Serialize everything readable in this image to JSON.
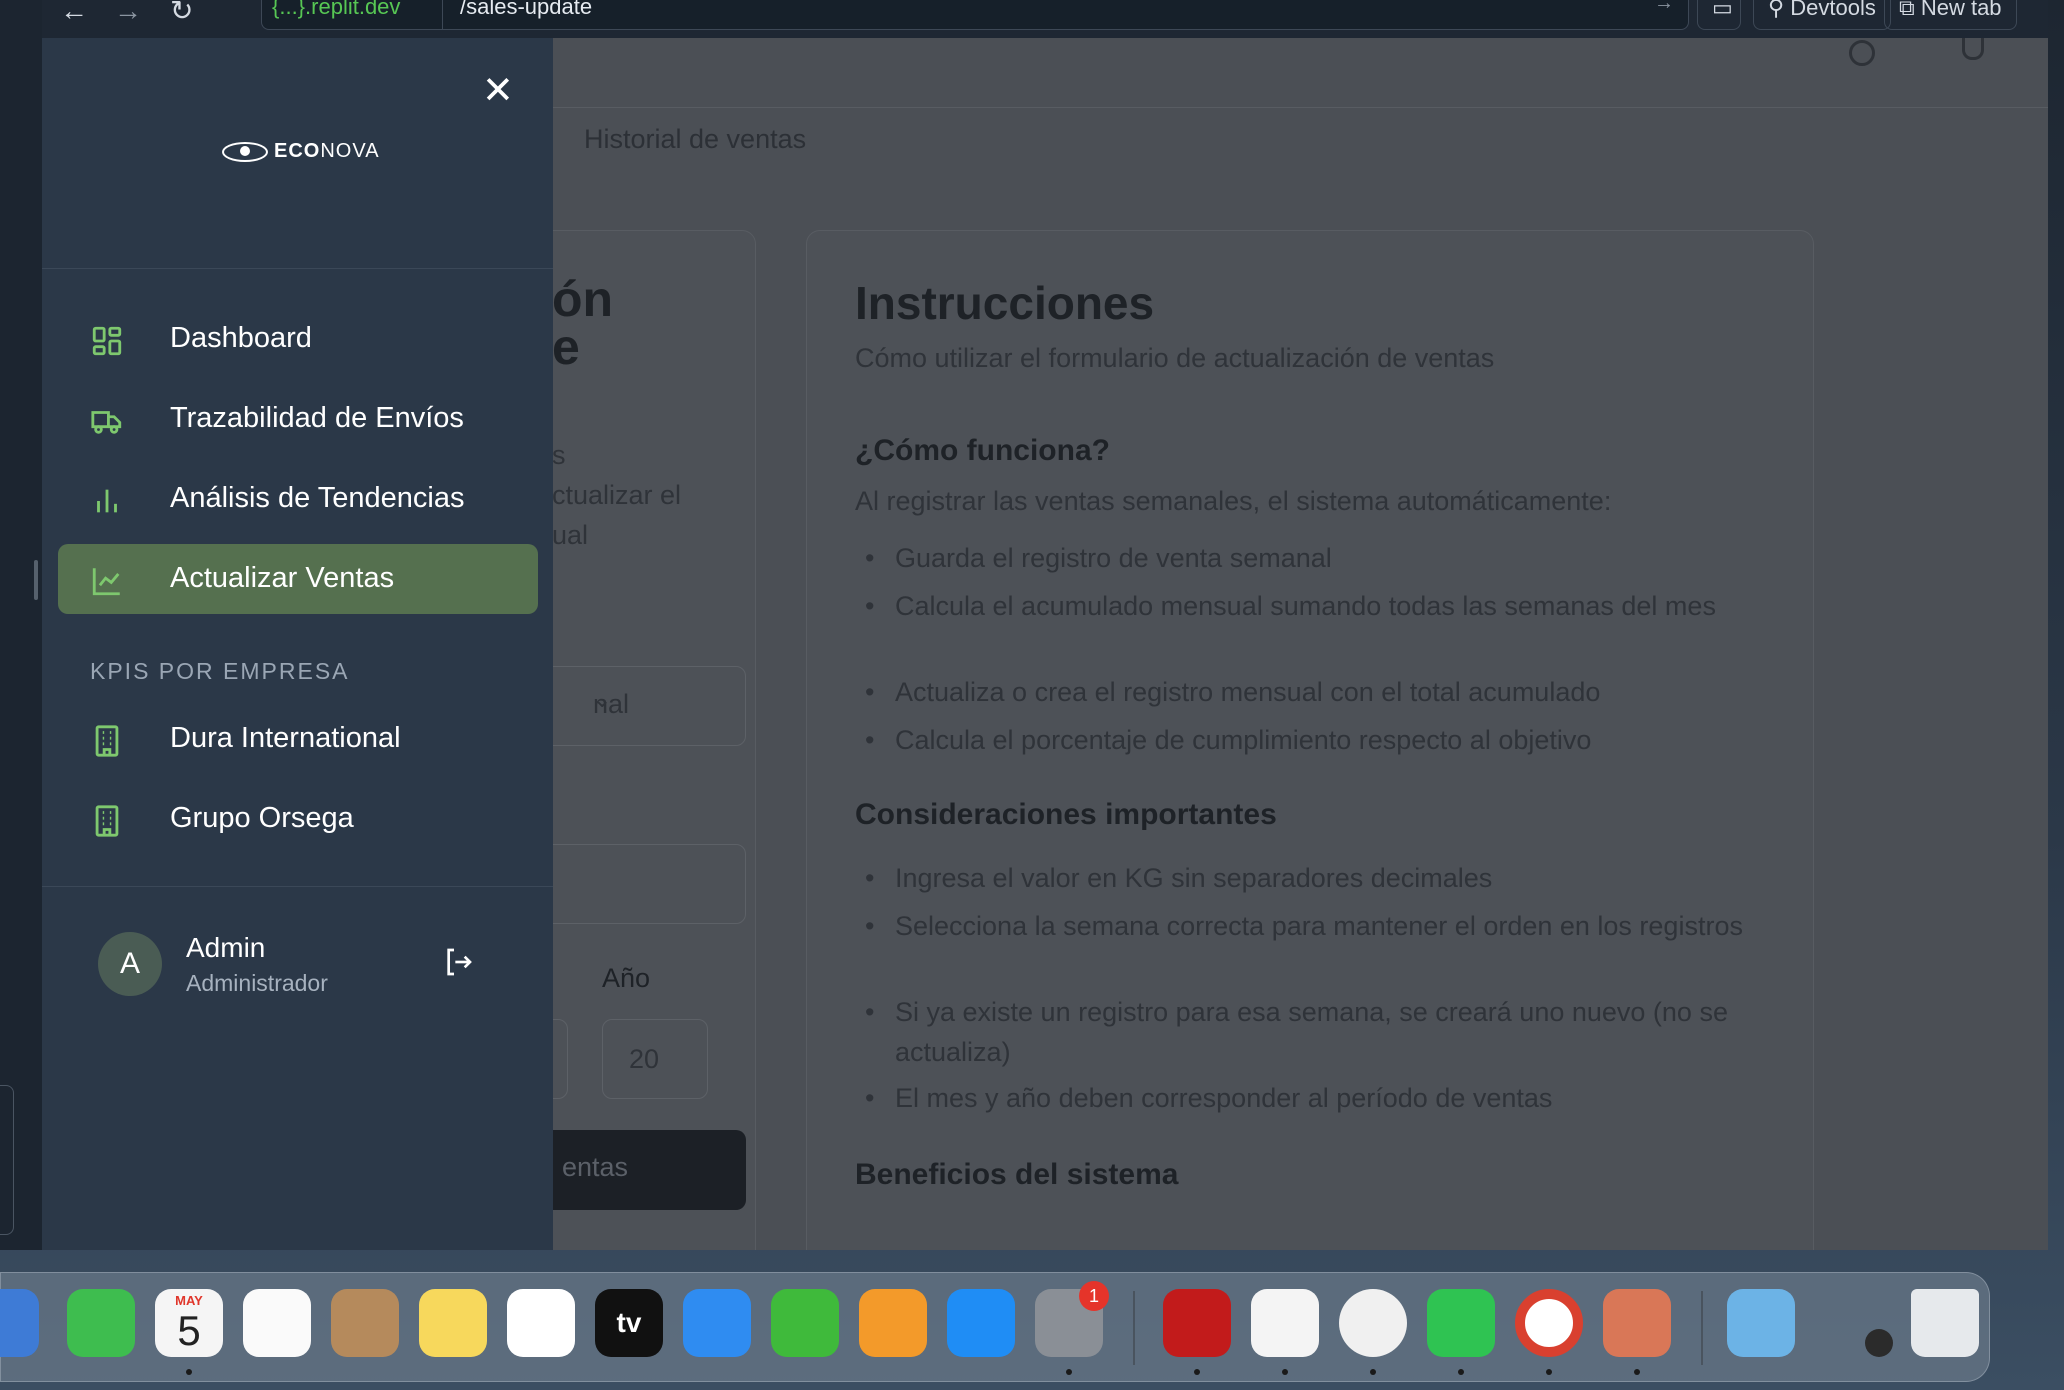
{
  "browser": {
    "url_host": "{...}.replit.dev",
    "url_path": "/sales-update",
    "devtools_label": "Devtools",
    "new_tab_label": "New tab"
  },
  "page": {
    "breadcrumb": "Historial de ventas",
    "form_title_partial": "ón\ne",
    "form_desc_partial": "s\nctualizar el\nual",
    "select_value_partial": "nal",
    "year_label": "Año",
    "year_value_partial": "20",
    "submit_partial": "entas"
  },
  "instructions": {
    "title": "Instrucciones",
    "subtitle": "Cómo utilizar el formulario de actualización de ventas",
    "section1_title": "¿Cómo funciona?",
    "section1_intro": "Al registrar las ventas semanales, el sistema automáticamente:",
    "section1_items": [
      "Guarda el registro de venta semanal",
      "Calcula el acumulado mensual sumando todas las semanas del mes",
      "Actualiza o crea el registro mensual con el total acumulado",
      "Calcula el porcentaje de cumplimiento respecto al objetivo"
    ],
    "section2_title": "Consideraciones importantes",
    "section2_items": [
      "Ingresa el valor en KG sin separadores decimales",
      "Selecciona la semana correcta para mantener el orden en los registros",
      "Si ya existe un registro para esa semana, se creará uno nuevo (no se actualiza)",
      "El mes y año deben corresponder al período de ventas"
    ],
    "section3_title": "Beneficios del sistema"
  },
  "sidebar": {
    "logo_text_bold": "ECO",
    "logo_text_rest": "NOVA",
    "nav": [
      {
        "label": "Dashboard",
        "icon": "dashboard-grid-icon"
      },
      {
        "label": "Trazabilidad de Envíos",
        "icon": "truck-icon"
      },
      {
        "label": "Análisis de Tendencias",
        "icon": "bar-chart-icon"
      },
      {
        "label": "Actualizar Ventas",
        "icon": "line-chart-icon",
        "active": true
      }
    ],
    "section_label": "KPIS POR EMPRESA",
    "companies": [
      {
        "label": "Dura International",
        "icon": "building-icon"
      },
      {
        "label": "Grupo Orsega",
        "icon": "building-icon"
      }
    ],
    "user": {
      "initial": "A",
      "name": "Admin",
      "role": "Administrador"
    }
  },
  "dock": {
    "calendar_month": "MAY",
    "calendar_day": "5",
    "settings_badge": "1",
    "appletv_label": "tv"
  },
  "colors": {
    "sidebar_bg": "#2b3848",
    "active_item_bg": "#55704f",
    "accent_green": "#7ec86e",
    "overlay_bg": "#4b4f55"
  }
}
